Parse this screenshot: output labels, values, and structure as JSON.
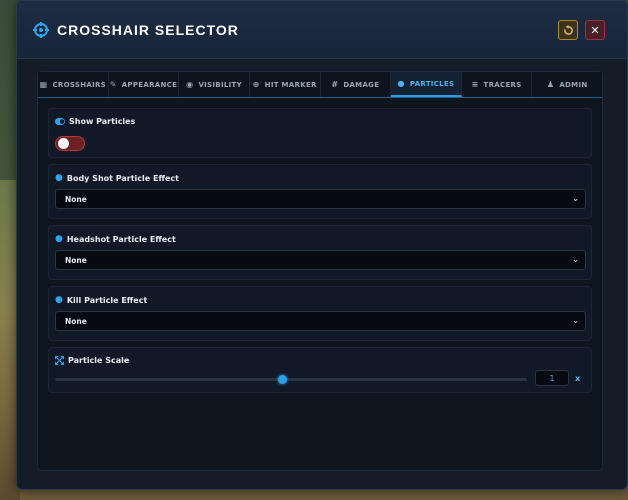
{
  "window": {
    "title": "CROSSHAIR SELECTOR",
    "title_icon": "crosshair-icon",
    "reset_icon": "reset-icon",
    "close_label": "✕"
  },
  "tabs": [
    {
      "label": "CROSSHAIRS",
      "icon": "grid-icon",
      "glyph": "▦",
      "active": false
    },
    {
      "label": "APPEARANCE",
      "icon": "brush-icon",
      "glyph": "✎",
      "active": false
    },
    {
      "label": "VISIBILITY",
      "icon": "eye-icon",
      "glyph": "◉",
      "active": false
    },
    {
      "label": "HIT MARKER",
      "icon": "target-icon",
      "glyph": "⊕",
      "active": false
    },
    {
      "label": "DAMAGE",
      "icon": "hash-icon",
      "glyph": "#",
      "active": false
    },
    {
      "label": "PARTICLES",
      "icon": "drop-icon",
      "glyph": "●",
      "active": true
    },
    {
      "label": "TRACERS",
      "icon": "bars-icon",
      "glyph": "≡",
      "active": false
    },
    {
      "label": "ADMIN",
      "icon": "user-gear-icon",
      "glyph": "♟",
      "active": false
    }
  ],
  "panels": {
    "show_particles": {
      "label": "Show Particles",
      "enabled": false
    },
    "body_shot": {
      "label": "Body Shot Particle Effect",
      "value": "None"
    },
    "headshot": {
      "label": "Headshot Particle Effect",
      "value": "None"
    },
    "kill": {
      "label": "Kill Particle Effect",
      "value": "None"
    },
    "particle_scale": {
      "label": "Particle Scale",
      "value": "1",
      "unit": "x",
      "slider_fraction": 0.48
    }
  },
  "colors": {
    "accent": "#2b9de0",
    "toggle_off": "#6d1f24",
    "close_button": "#a03040",
    "reset_button": "#b08a2a"
  }
}
